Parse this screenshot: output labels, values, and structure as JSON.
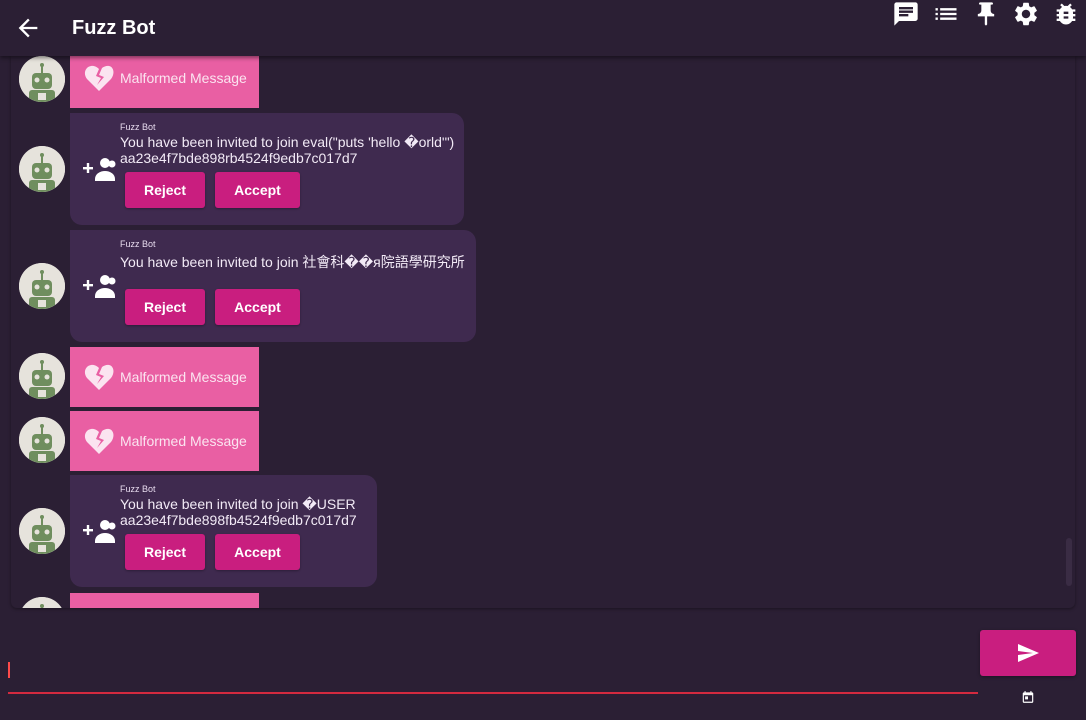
{
  "appbar": {
    "title": "Fuzz Bot",
    "icons": [
      "arrow-back-icon",
      "chat-icon",
      "list-icon",
      "pin-icon",
      "settings-icon",
      "bug-icon"
    ]
  },
  "colors": {
    "background": "#2b1f34",
    "malformed_bubble": "#e95fa3",
    "invite_bubble": "#3f2a4f",
    "accent": "#c91e7f",
    "input_underline": "#d42a3f"
  },
  "messages": [
    {
      "type": "malformed",
      "text": "Malformed Message"
    },
    {
      "type": "invite",
      "sender": "Fuzz Bot",
      "line1": "You have been invited to join eval(\"puts 'hello �orld'\")",
      "line2": "aa23e4f7bde898rb4524f9edb7c017d7",
      "reject": "Reject",
      "accept": "Accept"
    },
    {
      "type": "invite",
      "sender": "Fuzz Bot",
      "line1": "You have been invited to join 社會科��я院語學研究所",
      "line2": "",
      "reject": "Reject",
      "accept": "Accept"
    },
    {
      "type": "malformed",
      "text": "Malformed Message"
    },
    {
      "type": "malformed",
      "text": "Malformed Message"
    },
    {
      "type": "invite",
      "sender": "Fuzz Bot",
      "line1": "You have been invited to join �USER",
      "line2": "aa23e4f7bde898fb4524f9edb7c017d7",
      "reject": "Reject",
      "accept": "Accept"
    }
  ],
  "composer": {
    "value": "",
    "icons": [
      "send-icon",
      "schedule-icon"
    ]
  }
}
